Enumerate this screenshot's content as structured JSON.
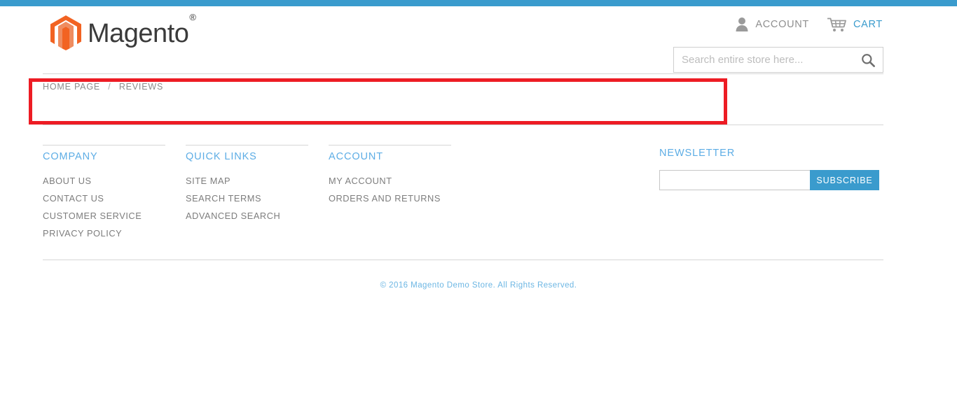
{
  "colors": {
    "brand_blue": "#3a9bcd",
    "link_blue": "#5dade5",
    "annotation_red": "#ed1c24",
    "muted_text": "#7d7d7d",
    "logo_orange": "#f26322"
  },
  "header": {
    "logo_text": "Magento",
    "logo_trademark": "®",
    "account_label": "ACCOUNT",
    "cart_label": "CART",
    "user_icon": "user-icon",
    "cart_icon": "cart-icon"
  },
  "search": {
    "placeholder": "Search entire store here...",
    "value": "",
    "icon": "search-icon"
  },
  "breadcrumb": {
    "items": [
      {
        "label": "HOME PAGE",
        "current": false
      },
      {
        "label": "REVIEWS",
        "current": true
      }
    ],
    "separator": "/"
  },
  "footer": {
    "columns": [
      {
        "title": "COMPANY",
        "links": [
          "ABOUT US",
          "CONTACT US",
          "CUSTOMER SERVICE",
          "PRIVACY POLICY"
        ]
      },
      {
        "title": "QUICK LINKS",
        "links": [
          "SITE MAP",
          "SEARCH TERMS",
          "ADVANCED SEARCH"
        ]
      },
      {
        "title": "ACCOUNT",
        "links": [
          "MY ACCOUNT",
          "ORDERS AND RETURNS"
        ]
      }
    ],
    "newsletter": {
      "title": "NEWSLETTER",
      "input_value": "",
      "input_placeholder": "",
      "button_label": "SUBSCRIBE"
    },
    "copyright": "© 2016 Magento Demo Store. All Rights Reserved."
  }
}
